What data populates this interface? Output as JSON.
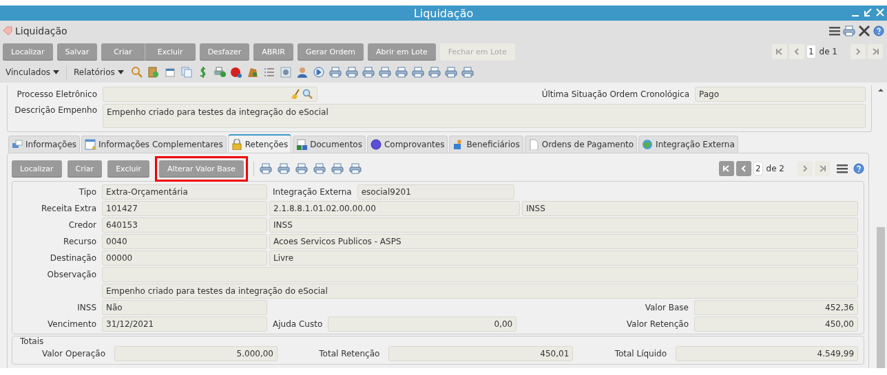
{
  "window": {
    "title": "Liquidação"
  },
  "header": {
    "title": "Liquidação"
  },
  "toolbar": {
    "buttons": [
      {
        "label": "Localizar",
        "disabled": false,
        "joined_to_next": false
      },
      {
        "label": "Salvar",
        "disabled": false,
        "joined_to_next": false
      },
      {
        "label": "Criar",
        "disabled": false,
        "joined_to_next": true
      },
      {
        "label": "Excluir",
        "disabled": false,
        "joined_to_next": false
      },
      {
        "label": "Desfazer",
        "disabled": false,
        "joined_to_next": false
      },
      {
        "label": "ABRIR",
        "disabled": false,
        "joined_to_next": false
      },
      {
        "label": "Gerar Ordem",
        "disabled": false,
        "joined_to_next": false
      },
      {
        "label": "Abrir em Lote",
        "disabled": false,
        "joined_to_next": false
      },
      {
        "label": "Fechar em Lote",
        "disabled": true,
        "joined_to_next": false
      }
    ],
    "pager": {
      "page": "1",
      "of": "de 1",
      "back_disabled": true,
      "forward_disabled": true
    },
    "menus": [
      "Vinculados",
      "Relatórios"
    ]
  },
  "form": {
    "processo_label": "Processo Eletrônico",
    "situacao_label": "Última Situação Ordem Cronológica",
    "situacao_value": "Pago",
    "descricao_label": "Descrição Empenho",
    "descricao_value": "Empenho criado para testes da integração do eSocial"
  },
  "tabs": [
    {
      "label": "Informações",
      "selected": false
    },
    {
      "label": "Informações Complementares",
      "selected": false
    },
    {
      "label": "Retenções",
      "selected": true
    },
    {
      "label": "Documentos",
      "selected": false
    },
    {
      "label": "Comprovantes",
      "selected": false
    },
    {
      "label": "Beneficiários",
      "selected": false
    },
    {
      "label": "Ordens de Pagamento",
      "selected": false
    },
    {
      "label": "Integração Externa",
      "selected": false
    }
  ],
  "panel": {
    "buttons": [
      {
        "label": "Localizar",
        "highlighted": false
      },
      {
        "label": "Criar",
        "highlighted": false
      },
      {
        "label": "Excluir",
        "highlighted": false
      },
      {
        "label": "Alterar Valor Base",
        "highlighted": true
      }
    ],
    "pager": {
      "page": "2",
      "of": "de 2",
      "back_disabled": false,
      "forward_disabled": true
    }
  },
  "retention": {
    "tipo": {
      "label": "Tipo",
      "value": "Extra-Orçamentária"
    },
    "integracao": {
      "label": "Integração Externa",
      "value": "esocial9201"
    },
    "receita": {
      "label": "Receita Extra",
      "value": "101427",
      "account": "2.1.8.8.1.01.02.00.00.00",
      "name": "INSS"
    },
    "credor": {
      "label": "Credor",
      "value": "640153",
      "name": "INSS"
    },
    "recurso": {
      "label": "Recurso",
      "value": "0040",
      "name": "Acoes Servicos Publicos - ASPS"
    },
    "destinacao": {
      "label": "Destinação",
      "value": "00000",
      "name": "Livre"
    },
    "observacao": {
      "label": "Observação",
      "text": "Empenho criado para testes da integração do eSocial"
    },
    "inss": {
      "label": "INSS",
      "value": "Não"
    },
    "valor_base": {
      "label": "Valor Base",
      "value": "452,36"
    },
    "vencimento": {
      "label": "Vencimento",
      "value": "31/12/2021"
    },
    "ajuda_custo": {
      "label": "Ajuda Custo",
      "value": "0,00"
    },
    "valor_retencao": {
      "label": "Valor Retenção",
      "value": "450,00"
    }
  },
  "totals": {
    "legend": "Totais",
    "items": [
      {
        "label": "Valor Operação",
        "value": "5.000,00"
      },
      {
        "label": "Total Retenção",
        "value": "450,01"
      },
      {
        "label": "Total Líquido",
        "value": "4.549,99"
      }
    ]
  }
}
